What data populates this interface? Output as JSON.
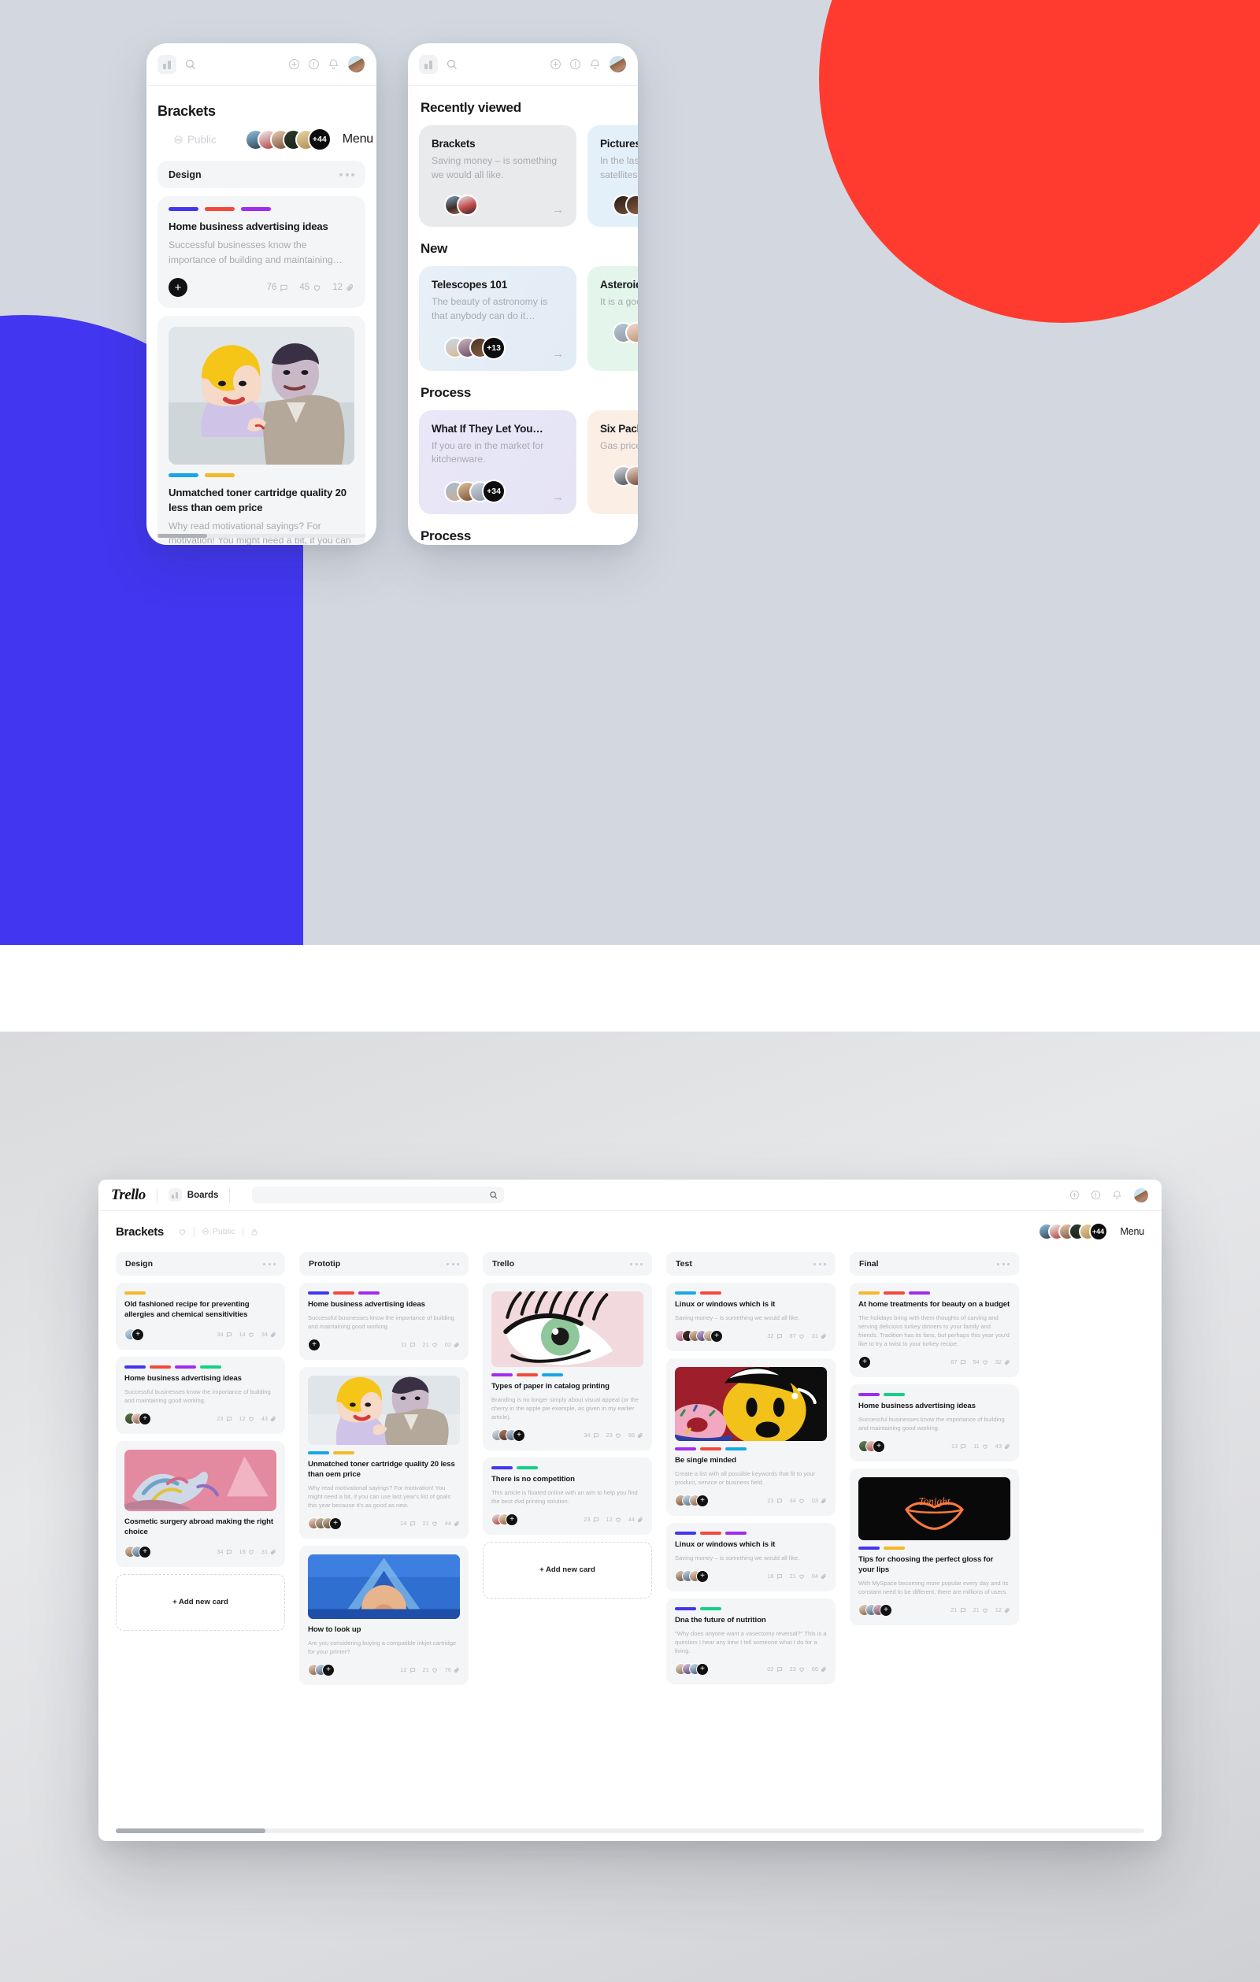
{
  "top_scene": {
    "phone_left": {
      "topbar": {
        "boards_icon": "boards-icon",
        "search_icon": "search-icon",
        "add_icon": "plus-circle-icon",
        "info_icon": "info-circle-icon",
        "bell_icon": "bell-icon",
        "avatar": "user-avatar"
      },
      "board_title": "Brackets",
      "favorite_icon": "heart-icon",
      "visibility": "Public",
      "visibility_icon": "globe-icon",
      "lock_icon": "lock-icon",
      "members_more": "+44",
      "menu_label": "Menu",
      "list": {
        "name": "Design",
        "more_icon": "more-dots-icon"
      },
      "cards": [
        {
          "labels": [
            "#4236f0",
            "#f4473b",
            "#a22bf0"
          ],
          "title": "Home business advertising ideas",
          "desc": "Successful businesses know the importance of building and maintaining…",
          "comments": "76",
          "likes": "45",
          "attachments": "12",
          "add_icon": "plus-icon",
          "comment_icon": "comment-icon",
          "heart_icon": "heart-icon",
          "clip_icon": "paperclip-icon"
        },
        {
          "labels": [
            "#18a6e8",
            "#f5b827"
          ],
          "image": "pop-art-couple",
          "title": "Unmatched toner cartridge quality 20 less than oem price",
          "desc": "Why read motivational sayings? For motivation! You might need a bit, if you can use last year's list of goals this year because it's as good as new."
        }
      ]
    },
    "phone_right": {
      "topbar": {
        "boards_icon": "boards-icon",
        "search_icon": "search-icon",
        "add_icon": "plus-circle-icon",
        "info_icon": "info-circle-icon",
        "bell_icon": "bell-icon",
        "avatar": "user-avatar"
      },
      "sections": [
        {
          "title": "Recently viewed",
          "cards": [
            {
              "title": "Brackets",
              "desc": "Saving money – is something we would all like.",
              "bg": "#e9eaec",
              "members_more": "",
              "arrow_icon": "arrow-right-icon"
            },
            {
              "title": "Pictures",
              "desc": "In the last few years FTA satellites",
              "bg": "#e4f0f9",
              "members_more": "",
              "arrow_icon": "arrow-right-icon"
            }
          ]
        },
        {
          "title": "New",
          "cards": [
            {
              "title": "Telescopes 101",
              "desc": "The beauty of astronomy is that anybody can do it…",
              "bg": "#e6eef7",
              "members_more": "+13",
              "arrow_icon": "arrow-right-icon"
            },
            {
              "title": "Asteroids",
              "desc": "It is a good PC as an…",
              "bg": "#e4f6ec",
              "members_more": "",
              "arrow_icon": "arrow-right-icon"
            }
          ]
        },
        {
          "title": "Process",
          "cards": [
            {
              "title": "What If They Let You…",
              "desc": "If you are in the market for kitchenware.",
              "bg": "#e7e6f7",
              "members_more": "+34",
              "arrow_icon": "arrow-right-icon"
            },
            {
              "title": "Six Pack",
              "desc": "Gas prices",
              "bg": "#fbeee4",
              "members_more": "",
              "arrow_icon": "arrow-right-icon"
            }
          ]
        },
        {
          "title": "Process",
          "cards": []
        }
      ]
    }
  },
  "bottom_scene": {
    "topbar": {
      "logo": "Trello",
      "boards_label": "Boards",
      "boards_icon": "boards-icon",
      "search_placeholder": "",
      "search_icon": "search-icon",
      "add_icon": "plus-circle-icon",
      "info_icon": "info-circle-icon",
      "bell_icon": "bell-icon",
      "avatar": "user-avatar"
    },
    "board_header": {
      "title": "Brackets",
      "favorite_icon": "heart-icon",
      "visibility": "Public",
      "visibility_icon": "globe-icon",
      "lock_icon": "lock-icon",
      "members_more": "+44",
      "menu_label": "Menu"
    },
    "add_card_label": "+ Add new card",
    "columns": [
      {
        "name": "Design",
        "more_icon": "more-dots-icon",
        "cards": [
          {
            "labels": [
              "#f5b827"
            ],
            "title": "Old fashioned recipe for preventing allergies and chemical sensitivities",
            "desc": "",
            "avatars": 1,
            "comments": "34",
            "likes": "14",
            "attachments": "34"
          },
          {
            "labels": [
              "#4236f0",
              "#f4473b",
              "#a22bf0",
              "#17cf87"
            ],
            "title": "Home business advertising ideas",
            "desc": "Successful businesses know the importance of building and maintaining good working.",
            "avatars": 2,
            "comments": "23",
            "likes": "12",
            "attachments": "43"
          },
          {
            "labels": [],
            "image": "hands-pink",
            "title": "Cosmetic surgery abroad making the right choice",
            "desc": "",
            "avatars": 2,
            "comments": "34",
            "likes": "16",
            "attachments": "31"
          }
        ],
        "has_add_card": true
      },
      {
        "name": "Prototip",
        "more_icon": "more-dots-icon",
        "cards": [
          {
            "labels": [
              "#4236f0",
              "#f4473b",
              "#a22bf0"
            ],
            "title": "Home business advertising ideas",
            "desc": "Successful businesses know the importance of building and maintaining good working.",
            "avatars": 1,
            "comments": "11",
            "likes": "21",
            "attachments": "02"
          },
          {
            "labels": [
              "#18a6e8",
              "#f5b827"
            ],
            "image": "pop-art-couple",
            "title": "Unmatched toner cartridge quality 20 less than oem price",
            "desc": "Why read motivational sayings? For motivation! You might need a bit, if you can use last year's list of goals this year because it's as good as new.",
            "avatars": 3,
            "comments": "14",
            "likes": "21",
            "attachments": "44"
          },
          {
            "labels": [],
            "image": "blue-abstract",
            "title": "How to look up",
            "desc": "Are you considering buying a compatible inkjet cartridge for your printer?",
            "avatars": 2,
            "comments": "12",
            "likes": "21",
            "attachments": "76"
          }
        ],
        "has_add_card": false
      },
      {
        "name": "Trello",
        "more_icon": "more-dots-icon",
        "cards": [
          {
            "labels": [
              "#a22bf0",
              "#f4473b",
              "#18a6e8"
            ],
            "image": "eye-lashes",
            "title": "Types of paper in catalog printing",
            "desc": "Branding is no longer simply about visual appeal (or the cherry in the apple pie example, as given in my earlier article).",
            "avatars": 3,
            "comments": "34",
            "likes": "23",
            "attachments": "98"
          },
          {
            "labels": [
              "#4236f0",
              "#17cf87"
            ],
            "title": "There is no competition",
            "desc": "This article is floated online with an aim to help you find the best dvd printing solution.",
            "avatars": 2,
            "comments": "23",
            "likes": "12",
            "attachments": "44"
          }
        ],
        "has_add_card": true
      },
      {
        "name": "Test",
        "more_icon": "more-dots-icon",
        "cards": [
          {
            "labels": [
              "#18a6e8",
              "#f4473b"
            ],
            "title": "Linux or windows which is it",
            "desc": "Saving money – is something we would all like.",
            "avatars": 5,
            "comments": "32",
            "likes": "87",
            "attachments": "31"
          },
          {
            "labels": [
              "#a22bf0",
              "#f4473b",
              "#18a6e8"
            ],
            "image": "yellow-cartoon",
            "title": "Be single minded",
            "desc": "Create a list with all possible keywords that fit to your product, service or business field.",
            "avatars": 3,
            "comments": "23",
            "likes": "34",
            "attachments": "03"
          },
          {
            "labels": [
              "#4236f0",
              "#f4473b",
              "#a22bf0"
            ],
            "title": "Linux or windows which is it",
            "desc": "Saving money – is something we would all like.",
            "avatars": 3,
            "comments": "16",
            "likes": "21",
            "attachments": "04"
          },
          {
            "labels": [
              "#4236f0",
              "#17cf87"
            ],
            "title": "Dna the future of nutrition",
            "desc": "\"Why does anyone want a vasectomy reversal?\" This is a question I hear any time I tell someone what I do for a living.",
            "avatars": 3,
            "comments": "02",
            "likes": "23",
            "attachments": "66"
          }
        ],
        "has_add_card": false
      },
      {
        "name": "Final",
        "more_icon": "more-dots-icon",
        "cards": [
          {
            "labels": [
              "#f5b827",
              "#f4473b",
              "#a22bf0"
            ],
            "title": "At home treatments for beauty on a budget",
            "desc": "The holidays bring with them thoughts of carving and serving delicious turkey dinners to your family and friends. Tradition has its fans, but perhaps this year you'd like to try a twist to your turkey recipe.",
            "avatars": 0,
            "comments": "87",
            "likes": "54",
            "attachments": "32"
          },
          {
            "labels": [
              "#a22bf0",
              "#17cf87"
            ],
            "title": "Home business advertising ideas",
            "desc": "Successful businesses know the importance of building and maintaining good working.",
            "avatars": 2,
            "comments": "13",
            "likes": "11",
            "attachments": "43"
          },
          {
            "labels": [
              "#4236f0",
              "#f5b827"
            ],
            "image": "neon-lips",
            "title": "Tips for choosing the perfect gloss for your lips",
            "desc": "With MySpace becoming more popular every day and its constant need to be different, there are millions of users.",
            "avatars": 3,
            "comments": "21",
            "likes": "21",
            "attachments": "12"
          }
        ],
        "has_add_card": false
      }
    ]
  }
}
